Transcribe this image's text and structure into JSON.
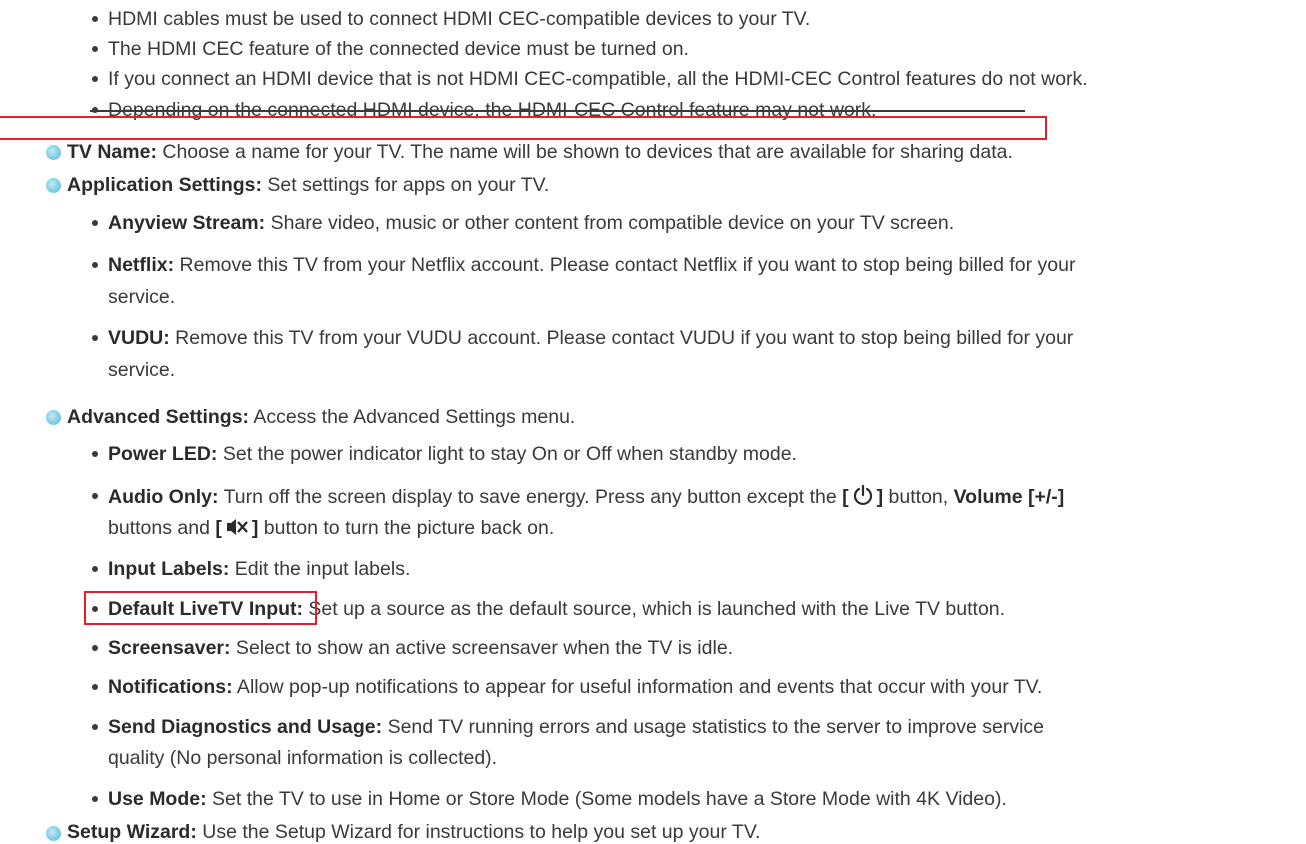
{
  "hdmi_notes": [
    "HDMI cables must be used to connect HDMI CEC-compatible devices to your TV.",
    "The HDMI CEC feature of the connected device must be turned on.",
    "If you connect an HDMI device that is not HDMI CEC-compatible, all the HDMI-CEC Control features do not work.",
    "Depending on the connected HDMI device, the HDMI-CEC Control feature may not work."
  ],
  "tv_name": {
    "term": "TV Name:",
    "text": " Choose a name for your TV. The name will be shown to devices that are available for sharing data."
  },
  "application_settings": {
    "term": "Application Settings:",
    "text": " Set settings for apps on your TV.",
    "items": [
      {
        "term": "Anyview Stream:",
        "text": " Share video, music or other content from compatible device on your TV screen."
      },
      {
        "term": "Netflix:",
        "text_line1": " Remove this TV from your Netflix account. Please contact Netflix if you want to stop being billed for your",
        "text_line2": "service."
      },
      {
        "term": "VUDU:",
        "text_line1": " Remove this TV from your VUDU account. Please contact VUDU if you want to stop being billed for your",
        "text_line2": "service."
      }
    ]
  },
  "advanced_settings": {
    "term": "Advanced Settings:",
    "text": " Access the Advanced Settings menu.",
    "power_led": {
      "term": "Power LED:",
      "text": " Set the power indicator light to stay On or Off when standby mode."
    },
    "audio_only": {
      "term": "Audio Only:",
      "text_a": " Turn off the screen display to save energy. Press any button except the ",
      "bracket_open": "[",
      "bracket_close": "]",
      "text_b": " button, ",
      "volume": "Volume [+/-]",
      "line2_a": "buttons and ",
      "line2_b": " button to turn the picture back on."
    },
    "input_labels": {
      "term": "Input Labels:",
      "text": " Edit the input labels."
    },
    "default_livetv": {
      "term": "Default LiveTV Input:",
      "text": " Set up a source as the default source, which is launched with the Live TV button."
    },
    "screensaver": {
      "term": "Screensaver:",
      "text": " Select to show an active screensaver when the TV is idle."
    },
    "notifications": {
      "term": "Notifications:",
      "text": " Allow pop-up notifications to appear for useful information and events that occur with your TV."
    },
    "diagnostics": {
      "term": "Send Diagnostics and Usage:",
      "text_line1": " Send TV running errors and usage statistics to the server to improve service",
      "text_line2": "quality (No personal information is collected)."
    },
    "use_mode": {
      "term": "Use Mode:",
      "text": " Set the TV to use in Home or Store Mode (Some models have a Store Mode with 4K Video)."
    }
  },
  "setup_wizard": {
    "term": "Setup Wizard:",
    "text": " Use the Setup Wizard for instructions to help you set up your TV."
  },
  "icons": {
    "power": "power-icon",
    "mute": "mute-icon"
  },
  "colors": {
    "highlight": "#e0202a",
    "accent_dot": "#7ccbe6",
    "text": "#3a3a3a"
  }
}
